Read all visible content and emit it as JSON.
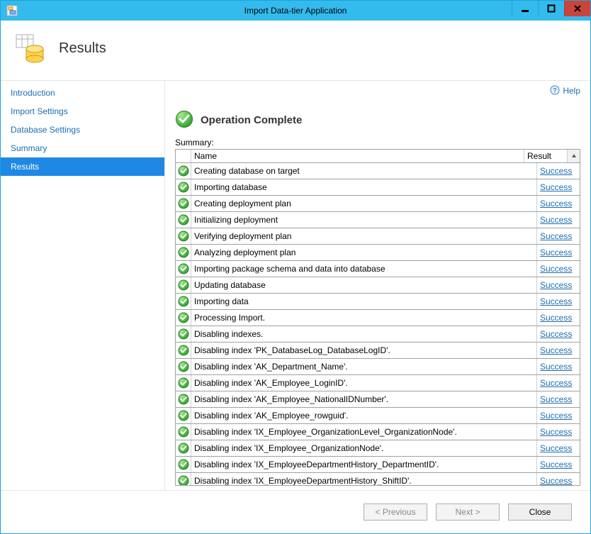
{
  "window": {
    "title": "Import Data-tier Application"
  },
  "header": {
    "title": "Results"
  },
  "sidebar": {
    "items": [
      {
        "label": "Introduction",
        "selected": false
      },
      {
        "label": "Import Settings",
        "selected": false
      },
      {
        "label": "Database Settings",
        "selected": false
      },
      {
        "label": "Summary",
        "selected": false
      },
      {
        "label": "Results",
        "selected": true
      }
    ]
  },
  "content": {
    "help_label": "Help",
    "status_label": "Operation Complete",
    "summary_label": "Summary:",
    "columns": {
      "name": "Name",
      "result": "Result"
    },
    "success_label": "Success",
    "rows": [
      {
        "name": "Creating database on target",
        "result": "Success"
      },
      {
        "name": "Importing database",
        "result": "Success"
      },
      {
        "name": "Creating deployment plan",
        "result": "Success"
      },
      {
        "name": "Initializing deployment",
        "result": "Success"
      },
      {
        "name": "Verifying deployment plan",
        "result": "Success"
      },
      {
        "name": "Analyzing deployment plan",
        "result": "Success"
      },
      {
        "name": "Importing package schema and data into database",
        "result": "Success"
      },
      {
        "name": "Updating database",
        "result": "Success"
      },
      {
        "name": "Importing data",
        "result": "Success"
      },
      {
        "name": "Processing Import.",
        "result": "Success"
      },
      {
        "name": "Disabling indexes.",
        "result": "Success"
      },
      {
        "name": "Disabling index 'PK_DatabaseLog_DatabaseLogID'.",
        "result": "Success"
      },
      {
        "name": "Disabling index 'AK_Department_Name'.",
        "result": "Success"
      },
      {
        "name": "Disabling index 'AK_Employee_LoginID'.",
        "result": "Success"
      },
      {
        "name": "Disabling index 'AK_Employee_NationalIDNumber'.",
        "result": "Success"
      },
      {
        "name": "Disabling index 'AK_Employee_rowguid'.",
        "result": "Success"
      },
      {
        "name": "Disabling index 'IX_Employee_OrganizationLevel_OrganizationNode'.",
        "result": "Success"
      },
      {
        "name": "Disabling index 'IX_Employee_OrganizationNode'.",
        "result": "Success"
      },
      {
        "name": "Disabling index 'IX_EmployeeDepartmentHistory_DepartmentID'.",
        "result": "Success"
      },
      {
        "name": "Disabling index 'IX_EmployeeDepartmentHistory_ShiftID'.",
        "result": "Success"
      }
    ]
  },
  "footer": {
    "previous": "< Previous",
    "next": "Next >",
    "close": "Close"
  }
}
